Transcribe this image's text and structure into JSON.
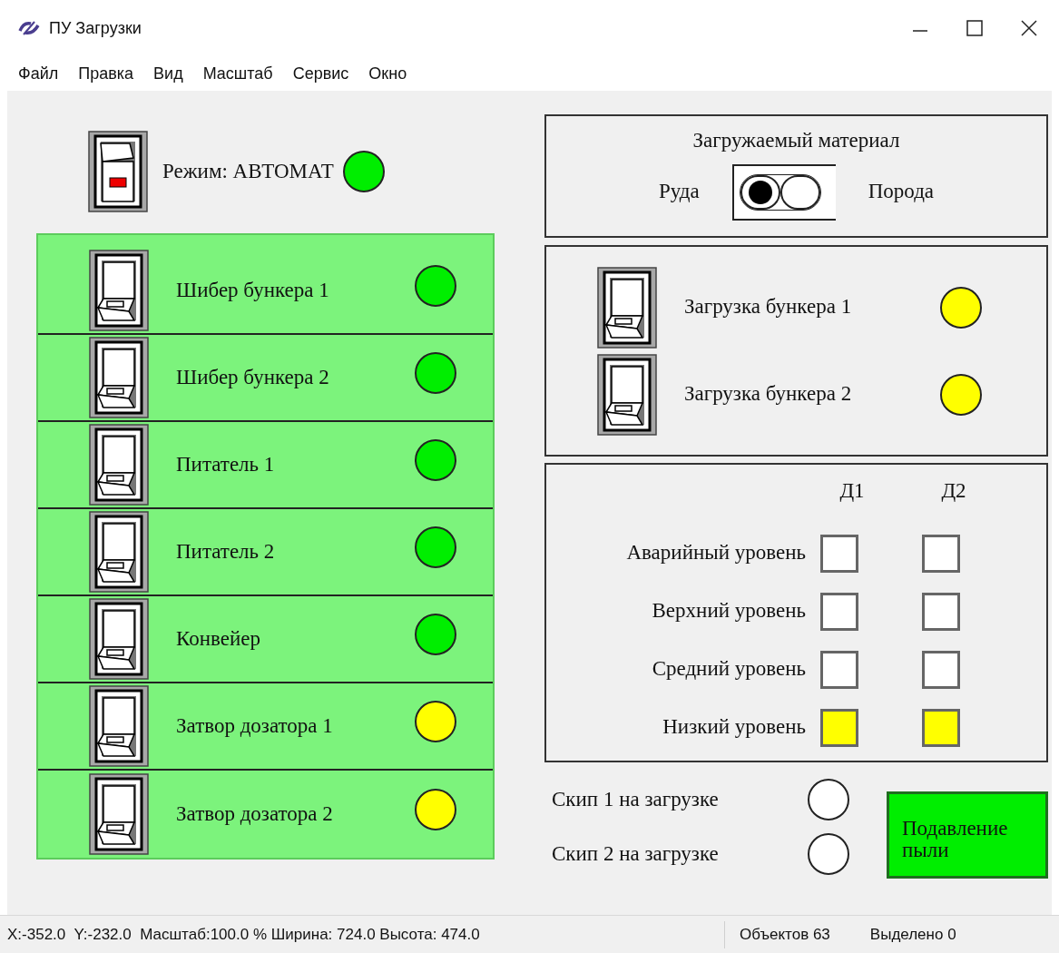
{
  "window": {
    "title": "ПУ Загрузки"
  },
  "menu": [
    "Файл",
    "Правка",
    "Вид",
    "Масштаб",
    "Сервис",
    "Окно"
  ],
  "mode": {
    "label": "Режим: АВТОМАТ",
    "switch_on": true,
    "color": "#00ee00"
  },
  "mechanisms": [
    {
      "label": "Шибер бункера 1",
      "switch_on": false,
      "color": "#00ee00"
    },
    {
      "label": "Шибер бункера 2",
      "switch_on": false,
      "color": "#00ee00"
    },
    {
      "label": "Питатель 1",
      "switch_on": false,
      "color": "#00ee00"
    },
    {
      "label": "Питатель 2",
      "switch_on": false,
      "color": "#00ee00"
    },
    {
      "label": "Конвейер",
      "switch_on": false,
      "color": "#00ee00"
    },
    {
      "label": "Затвор дозатора 1",
      "switch_on": false,
      "color": "#ffff00"
    },
    {
      "label": "Затвор дозатора 2",
      "switch_on": false,
      "color": "#ffff00"
    }
  ],
  "material": {
    "title": "Загружаемый материал",
    "options": [
      {
        "label": "Руда",
        "selected": true
      },
      {
        "label": "Порода",
        "selected": false
      }
    ]
  },
  "loading": [
    {
      "label": "Загрузка бункера 1",
      "switch_on": false,
      "color": "#ffff00"
    },
    {
      "label": "Загрузка бункера 2",
      "switch_on": false,
      "color": "#ffff00"
    }
  ],
  "levels": {
    "columns": [
      "Д1",
      "Д2"
    ],
    "rows": [
      {
        "label": "Аварийный уровень",
        "cells": [
          {
            "color": "#ffffff"
          },
          {
            "color": "#ffffff"
          }
        ]
      },
      {
        "label": "Верхний уровень",
        "cells": [
          {
            "color": "#ffffff"
          },
          {
            "color": "#ffffff"
          }
        ]
      },
      {
        "label": "Средний уровень",
        "cells": [
          {
            "color": "#ffffff"
          },
          {
            "color": "#ffffff"
          }
        ]
      },
      {
        "label": "Низкий уровень",
        "cells": [
          {
            "color": "#ffff00"
          },
          {
            "color": "#ffff00"
          }
        ]
      }
    ]
  },
  "skips": [
    {
      "label": "Скип 1 на загрузке",
      "color": "#ffffff"
    },
    {
      "label": "Скип 2 на загрузке",
      "color": "#ffffff"
    }
  ],
  "dust_button": {
    "label": "Подавление пыли",
    "color": "#00ee00"
  },
  "status_bar": {
    "coords": "X:-352.0  Y:-232.0  Масштаб:100.0 % Ширина: 724.0 Высота: 474.0",
    "objects": "Объектов 63",
    "selected": "Выделено 0"
  }
}
